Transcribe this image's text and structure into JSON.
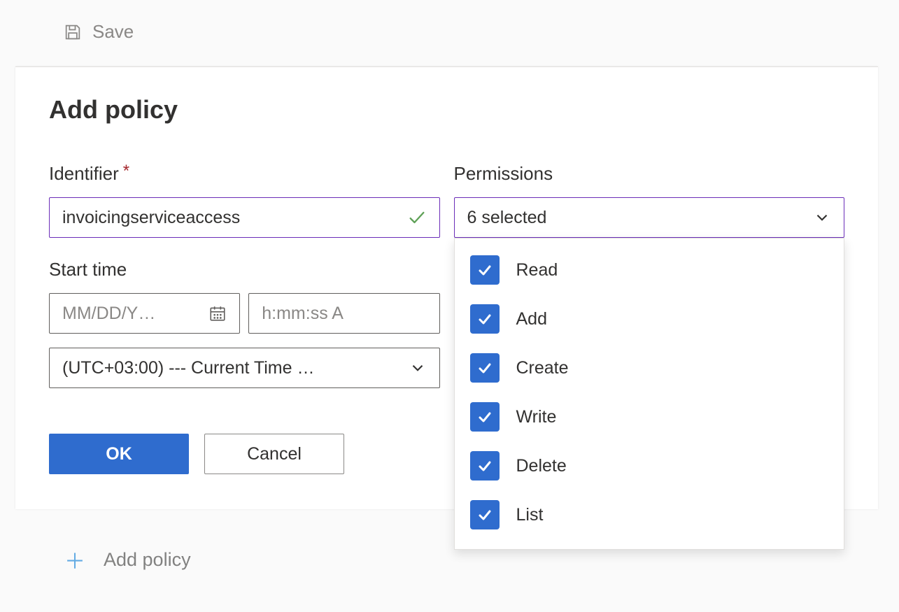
{
  "toolbar": {
    "save_label": "Save"
  },
  "panel": {
    "title": "Add policy"
  },
  "identifier": {
    "label": "Identifier",
    "required_mark": "*",
    "value": "invoicingserviceaccess"
  },
  "start_time": {
    "label": "Start time",
    "date_placeholder": "MM/DD/Y…",
    "time_placeholder": "h:mm:ss A",
    "timezone_value": "(UTC+03:00) --- Current Time …"
  },
  "permissions": {
    "label": "Permissions",
    "summary": "6 selected",
    "options": [
      {
        "label": "Read",
        "checked": true
      },
      {
        "label": "Add",
        "checked": true
      },
      {
        "label": "Create",
        "checked": true
      },
      {
        "label": "Write",
        "checked": true
      },
      {
        "label": "Delete",
        "checked": true
      },
      {
        "label": "List",
        "checked": true
      }
    ]
  },
  "buttons": {
    "ok": "OK",
    "cancel": "Cancel"
  },
  "peek": {
    "add_policy": "Add policy"
  },
  "colors": {
    "primary": "#2f6cce",
    "accent_border": "#6b2db8",
    "required": "#a4262c",
    "muted": "#8a8886"
  }
}
